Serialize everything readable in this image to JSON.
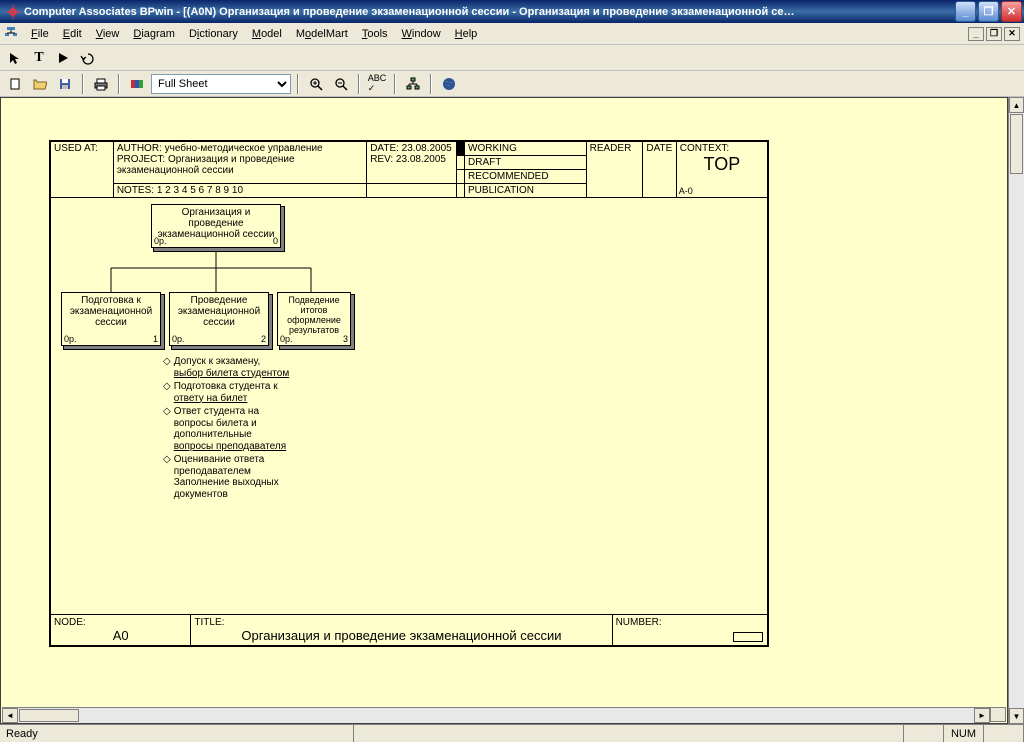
{
  "title": "Computer Associates BPwin - [(A0N) Организация и проведение  экзаменационной сессии    - Организация и проведение экзаменационной се…",
  "menu": {
    "file": "File",
    "edit": "Edit",
    "view": "View",
    "diagram": "Diagram",
    "dictionary": "Dictionary",
    "model": "Model",
    "modelmart": "ModelMart",
    "tools": "Tools",
    "window": "Window",
    "help": "Help"
  },
  "zoom_value": "Full Sheet",
  "header": {
    "usedat": "USED AT:",
    "author": "AUTHOR:  учебно-методическое управление",
    "project": "PROJECT:  Организация и проведение экзаменационной сессии",
    "notes": "NOTES:  1  2  3  4  5  6  7  8  9  10",
    "date": "DATE: 23.08.2005",
    "rev": "REV:  23.08.2005",
    "working": "WORKING",
    "draft": "DRAFT",
    "recommended": "RECOMMENDED",
    "publication": "PUBLICATION",
    "reader": "READER",
    "dateh": "DATE",
    "context": "CONTEXT:",
    "top": "TOP",
    "a0": "A-0"
  },
  "nodes": {
    "root": {
      "label": "Организация и проведение экзаменационной сессии",
      "num": "0",
      "pr": "0р."
    },
    "n1": {
      "label": "Подготовка к экзаменационной сессии",
      "num": "1",
      "pr": "0р."
    },
    "n2": {
      "label": "Проведение экзаменационной сессии",
      "num": "2",
      "pr": "0р."
    },
    "n3": {
      "label": "Подведение итогов оформление результатов",
      "num": "3",
      "pr": "0р."
    }
  },
  "bullets": {
    "b1a": "Допуск к экзамену,",
    "b1b": "выбор билета студентом",
    "b2a": "Подготовка студента к",
    "b2b": "ответу  на билет",
    "b3a": "Ответ студента на",
    "b3b": "вопросы билета и",
    "b3c": "дополнительные",
    "b3d": "вопросы преподавателя",
    "b4a": "Оценивание ответа",
    "b4b": "преподавателем",
    "b4c": "Заполнение выходных",
    "b4d": "документов"
  },
  "footer": {
    "node_l": "NODE:",
    "node_v": "A0",
    "title_l": "TITLE:",
    "title_v": "Организация и проведение  экзаменационной сессии",
    "number_l": "NUMBER:"
  },
  "status": {
    "ready": "Ready",
    "num": "NUM"
  }
}
